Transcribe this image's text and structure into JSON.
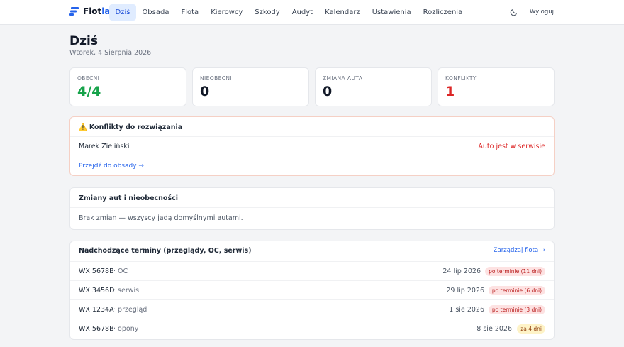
{
  "brand": {
    "name_part1": "Flot",
    "name_part2": "ia"
  },
  "nav": {
    "items": [
      "Dziś",
      "Obsada",
      "Flota",
      "Kierowcy",
      "Szkody",
      "Audyt",
      "Kalendarz",
      "Ustawienia",
      "Rozliczenia"
    ],
    "active": "Dziś"
  },
  "header": {
    "logout": "Wyloguj",
    "theme_icon": "moon-icon"
  },
  "page": {
    "title": "Dziś",
    "date": "Wtorek, 4 Sierpnia 2026"
  },
  "stats": [
    {
      "label": "OBECNI",
      "value": "4/4",
      "color": "#16a34a"
    },
    {
      "label": "NIEOBECNI",
      "value": "0",
      "color": "#111827"
    },
    {
      "label": "ZMIANA AUTA",
      "value": "0",
      "color": "#111827"
    },
    {
      "label": "KONFLIKTY",
      "value": "1",
      "color": "#dc2626"
    }
  ],
  "conflicts": {
    "icon": "warning-icon",
    "icon_glyph": "⚠️",
    "title": "Konflikty do rozwiązania",
    "rows": [
      {
        "name": "Marek Zieliński",
        "issue": "Auto jest w serwisie"
      }
    ],
    "link": "Przejdź do obsady →"
  },
  "changes": {
    "title": "Zmiany aut i nieobecności",
    "empty_text": "Brak zmian — wszyscy jadą domyślnymi autami."
  },
  "terms": {
    "title": "Nadchodzące terminy (przeglądy, OC, serwis)",
    "link": "Zarządzaj flotą →",
    "rows": [
      {
        "plate": "WX 5678B",
        "type": "· OC",
        "date": "24 lip 2026",
        "badge": "po terminie (11 dni)",
        "status": "overdue"
      },
      {
        "plate": "WX 3456D",
        "type": "· serwis",
        "date": "29 lip 2026",
        "badge": "po terminie (6 dni)",
        "status": "overdue"
      },
      {
        "plate": "WX 1234A",
        "type": "· przegląd",
        "date": "1 sie 2026",
        "badge": "po terminie (3 dni)",
        "status": "overdue"
      },
      {
        "plate": "WX 5678B",
        "type": "· opony",
        "date": "8 sie 2026",
        "badge": "za 4 dni",
        "status": "upcoming"
      }
    ]
  },
  "colors": {
    "accent": "#2563eb",
    "danger": "#dc2626",
    "success": "#16a34a",
    "overdue_bg": "#fde2e2",
    "overdue_fg": "#b91c1c",
    "upcoming_bg": "#fef3c7",
    "upcoming_fg": "#92400e"
  }
}
